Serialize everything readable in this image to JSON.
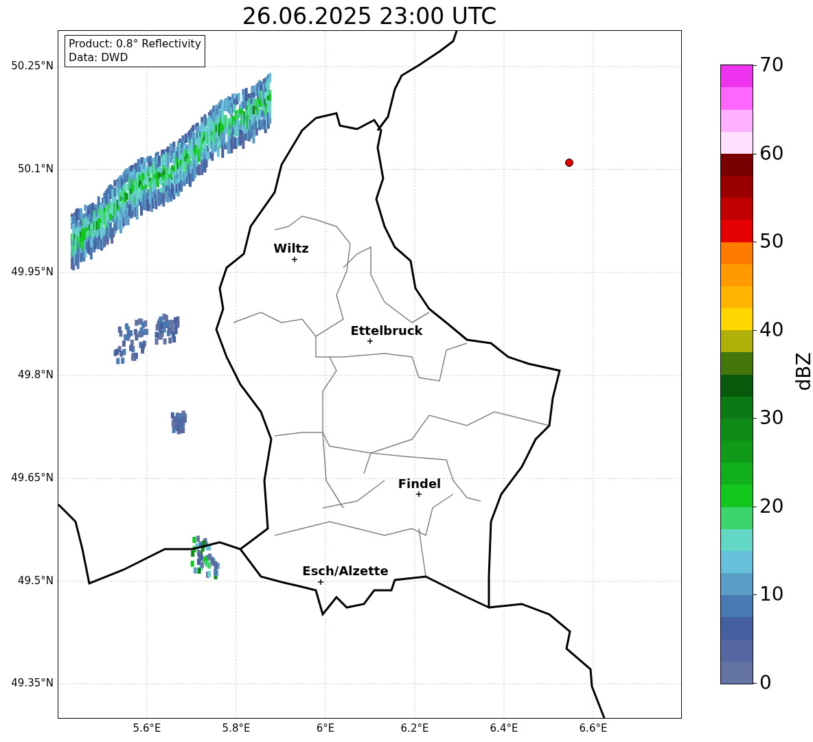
{
  "title": "26.06.2025 23:00 UTC",
  "info": [
    "Product: 0.8° Reflectivity",
    "Data: DWD"
  ],
  "lat_ticks": [
    "50.25°N",
    "50.1°N",
    "49.95°N",
    "49.8°N",
    "49.65°N",
    "49.5°N",
    "49.35°N"
  ],
  "lon_ticks": [
    "5.6°E",
    "5.8°E",
    "6°E",
    "6.2°E",
    "6.4°E",
    "6.6°E"
  ],
  "cities": [
    {
      "name": "Wiltz"
    },
    {
      "name": "Ettelbruck"
    },
    {
      "name": "Findel"
    },
    {
      "name": "Esch/Alzette"
    }
  ],
  "colorbar": {
    "label": "dBZ",
    "ticks": [
      "70",
      "60",
      "50",
      "40",
      "30",
      "20",
      "10",
      "0"
    ],
    "bins": [
      {
        "color": "#6474a4"
      },
      {
        "color": "#5566a0"
      },
      {
        "color": "#4560a0"
      },
      {
        "color": "#4a7ab4"
      },
      {
        "color": "#5a9ec8"
      },
      {
        "color": "#66c0dc"
      },
      {
        "color": "#62d8c4"
      },
      {
        "color": "#3cd46c"
      },
      {
        "color": "#12c81c"
      },
      {
        "color": "#10b01a"
      },
      {
        "color": "#109a18"
      },
      {
        "color": "#0e8a16"
      },
      {
        "color": "#0c7a14"
      },
      {
        "color": "#0a5a0e"
      },
      {
        "color": "#44760c"
      },
      {
        "color": "#b0b00a"
      },
      {
        "color": "#ffd600"
      },
      {
        "color": "#ffb400"
      },
      {
        "color": "#ff9a00"
      },
      {
        "color": "#ff7a00"
      },
      {
        "color": "#e40000"
      },
      {
        "color": "#c00000"
      },
      {
        "color": "#9a0000"
      },
      {
        "color": "#780000"
      },
      {
        "color": "#ffe0ff"
      },
      {
        "color": "#ffb0ff"
      },
      {
        "color": "#ff66ff"
      },
      {
        "color": "#ee33ee"
      }
    ]
  }
}
